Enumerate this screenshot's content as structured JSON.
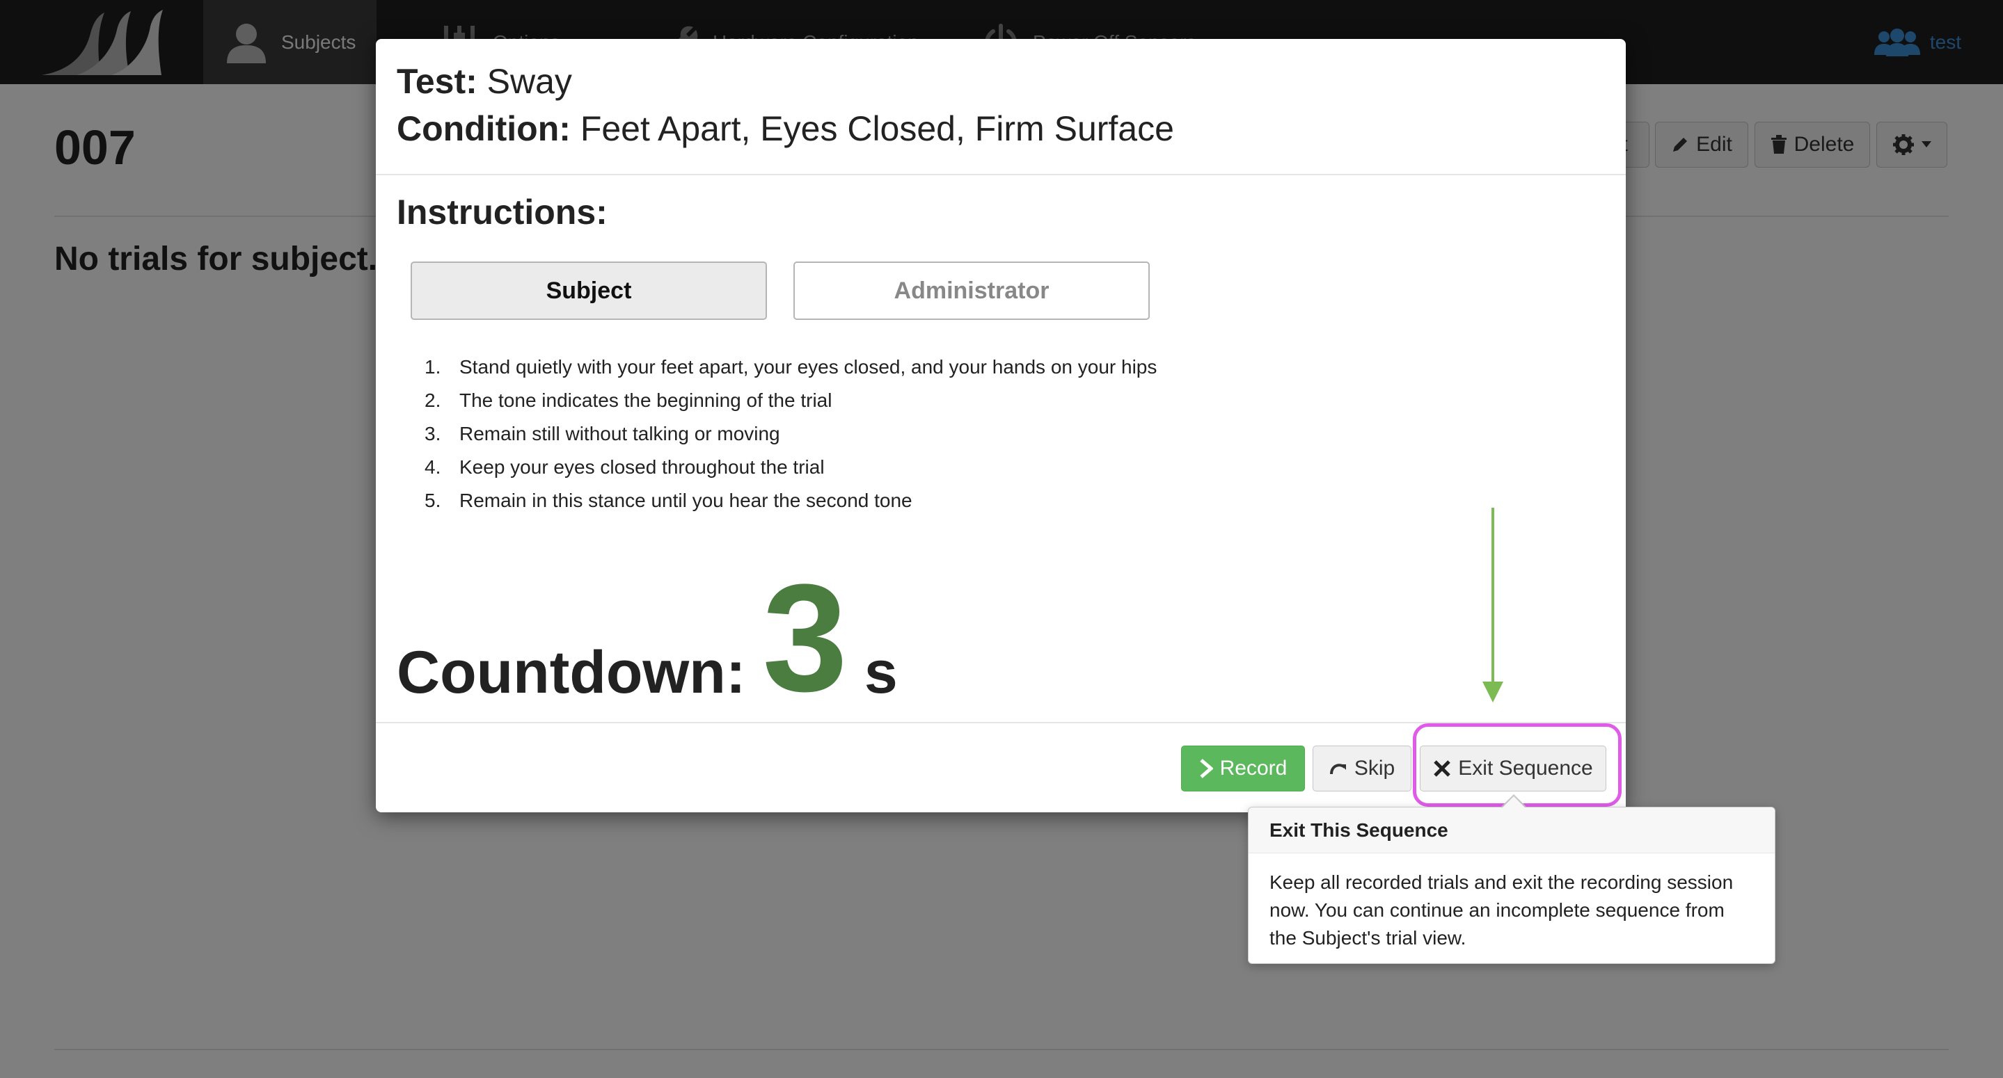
{
  "navbar": {
    "tabs": [
      {
        "label": "Subjects",
        "icon": "user-icon",
        "active": true
      },
      {
        "label": "Options",
        "icon": "sliders-icon",
        "active": false
      },
      {
        "label": "Hardware Configuration",
        "icon": "wrench-icon",
        "active": false
      },
      {
        "label": "Power Off Sensors",
        "icon": "power-icon",
        "active": false
      }
    ],
    "user": {
      "label": "test",
      "icon": "users-icon"
    }
  },
  "page": {
    "title": "007",
    "empty_message": "No trials for subject.",
    "toolbar": {
      "partial_label": "t",
      "edit_label": "Edit",
      "delete_label": "Delete"
    }
  },
  "modal": {
    "test_label": "Test:",
    "test_value": "Sway",
    "condition_label": "Condition:",
    "condition_value": "Feet Apart, Eyes Closed, Firm Surface",
    "instructions_title": "Instructions:",
    "role_tabs": [
      {
        "label": "Subject",
        "active": true
      },
      {
        "label": "Administrator",
        "active": false
      }
    ],
    "steps": [
      {
        "num": "1.",
        "text": "Stand quietly with your feet apart, your eyes closed, and your hands on your hips"
      },
      {
        "num": "2.",
        "text": "The tone indicates the beginning of the trial"
      },
      {
        "num": "3.",
        "text": "Remain still without talking or moving"
      },
      {
        "num": "4.",
        "text": "Keep your eyes closed throughout the trial"
      },
      {
        "num": "5.",
        "text": "Remain in this stance until you hear the second tone"
      }
    ],
    "countdown": {
      "label": "Countdown:",
      "value": "3",
      "unit": "s"
    },
    "footer": {
      "record_label": "Record",
      "skip_label": "Skip",
      "exit_label": "Exit Sequence"
    }
  },
  "popover": {
    "title": "Exit This Sequence",
    "body": "Keep all recorded trials and exit the recording session now. You can continue an incomplete sequence from the Subject's trial view."
  },
  "colors": {
    "navbar_bg": "#1f1f1f",
    "record_green": "#5cb85c",
    "countdown_green": "#4a7d3f",
    "highlight_magenta": "#e05ce8",
    "arrow_green": "#7cba54",
    "user_link_blue": "#3c8ed8"
  }
}
